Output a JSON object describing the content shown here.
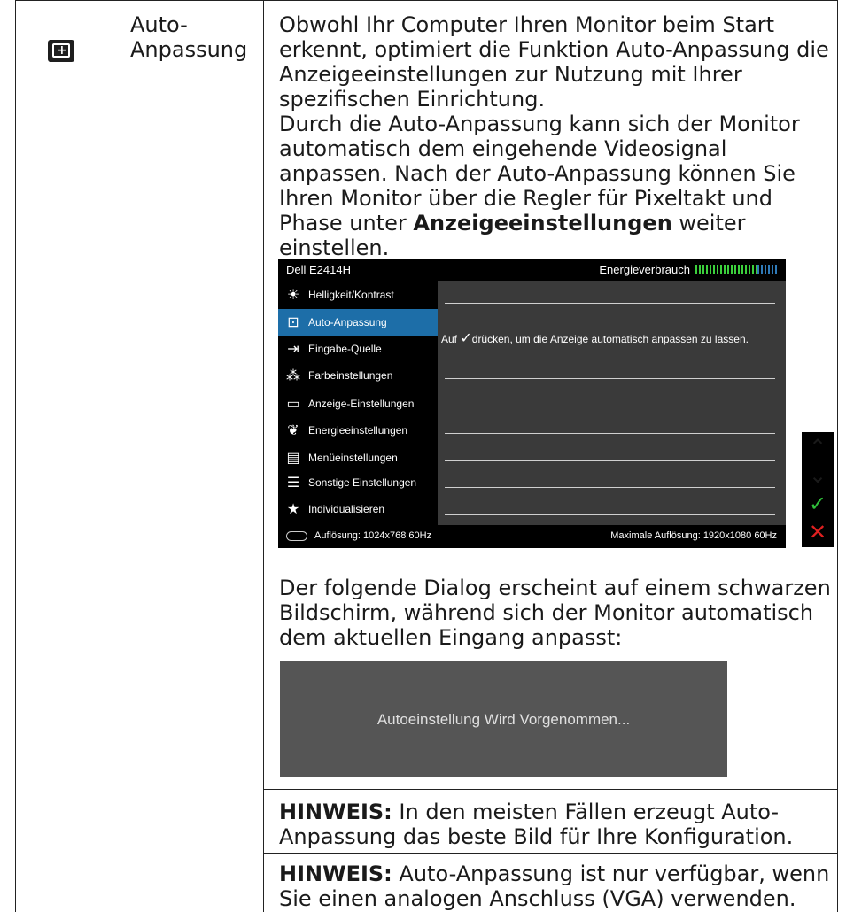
{
  "feature": {
    "title_line1": "Auto-",
    "title_line2": "Anpassung",
    "icon": "auto-adjust-icon"
  },
  "description": {
    "p1": "Obwohl Ihr Computer Ihren Monitor beim Start erkennt, optimiert die Funktion Auto-Anpassung die Anzeigeeinstellungen zur Nutzung mit Ihrer spezifischen Einrichtung.",
    "p2_pre": "Durch die Auto-Anpassung kann sich der Monitor automatisch dem eingehende Videosignal anpassen. Nach der Auto-Anpassung können Sie Ihren Monitor über die Regler für Pixeltakt und Phase unter ",
    "p2_bold": "Anzeigeeinstellungen",
    "p2_post": " weiter einstellen."
  },
  "osd": {
    "model": "Dell E2414H",
    "energy_label": "Energieverbrauch",
    "menu": [
      {
        "label": "Helligkeit/Kontrast",
        "icon": "brightness-icon",
        "glyph": "☀"
      },
      {
        "label": "Auto-Anpassung",
        "icon": "auto-adjust-icon",
        "glyph": "⊡"
      },
      {
        "label": "Eingabe-Quelle",
        "icon": "input-source-icon",
        "glyph": "⇥"
      },
      {
        "label": "Farbeinstellungen",
        "icon": "color-icon",
        "glyph": "⁂"
      },
      {
        "label": "Anzeige-Einstellungen",
        "icon": "display-icon",
        "glyph": "▭"
      },
      {
        "label": "Energieeinstellungen",
        "icon": "energy-leaf-icon",
        "glyph": "❦"
      },
      {
        "label": "Menüeinstellungen",
        "icon": "menu-settings-icon",
        "glyph": "▤"
      },
      {
        "label": "Sonstige Einstellungen",
        "icon": "other-settings-icon",
        "glyph": "☰"
      },
      {
        "label": "Individualisieren",
        "icon": "star-icon",
        "glyph": "★"
      }
    ],
    "selected_index": 1,
    "message_pre": "Auf ",
    "message_check": "✓",
    "message_post": "drücken, um die Anzeige automatisch anpassen zu lassen.",
    "resolution": "Auflösung: 1024x768 60Hz",
    "max_resolution": "Maximale Auflösung: 1920x1080 60Hz",
    "controls": [
      {
        "glyph": "⌃",
        "icon": "up-icon",
        "color": "#ffffff"
      },
      {
        "glyph": "⌄",
        "icon": "down-icon",
        "color": "#ffffff"
      },
      {
        "glyph": "✓",
        "icon": "check-icon",
        "color": "#2fbf3a"
      },
      {
        "glyph": "✕",
        "icon": "close-icon",
        "color": "#e02020"
      }
    ]
  },
  "para2": "Der folgende Dialog erscheint auf einem schwarzen Bildschirm, während sich der Monitor automatisch dem aktuellen Eingang anpasst:",
  "dialog_text": "Autoeinstellung Wird Vorgenommen...",
  "notes": [
    {
      "keyword": "HINWEIS:",
      "text": " In den meisten Fällen erzeugt Auto-Anpassung das beste Bild für Ihre Konfiguration."
    },
    {
      "keyword": "HINWEIS:",
      "text": " Auto-Anpassung ist nur verfügbar, wenn Sie einen analogen Anschluss (VGA) verwenden."
    }
  ]
}
